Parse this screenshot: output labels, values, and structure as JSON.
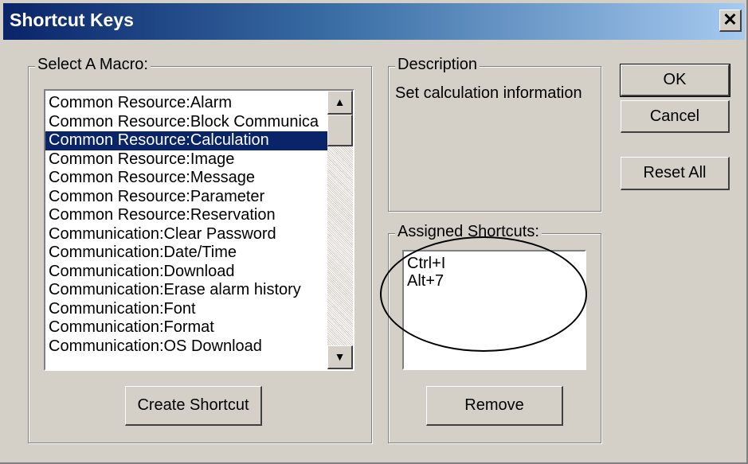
{
  "window": {
    "title": "Shortcut Keys",
    "close_glyph": "✕"
  },
  "macro_group": {
    "label": "Select A Macro:",
    "items": [
      "Common Resource:Alarm",
      "Common Resource:Block Communica",
      "Common Resource:Calculation",
      "Common Resource:Image",
      "Common Resource:Message",
      "Common Resource:Parameter",
      "Common Resource:Reservation",
      "Communication:Clear Password",
      "Communication:Date/Time",
      "Communication:Download",
      "Communication:Erase alarm history",
      "Communication:Font",
      "Communication:Format",
      "Communication:OS Download"
    ],
    "selected": "Common Resource:Calculation",
    "create_button": "Create Shortcut"
  },
  "description_group": {
    "label": "Description",
    "text": "Set calculation information"
  },
  "shortcuts_group": {
    "label": "Assigned Shortcuts:",
    "items": [
      "Ctrl+I",
      "Alt+7"
    ],
    "remove_button": "Remove"
  },
  "buttons": {
    "ok": "OK",
    "cancel": "Cancel",
    "reset_all": "Reset All"
  },
  "colors": {
    "selection": "#0a246a",
    "dialog_bg": "#d4d0c8"
  }
}
